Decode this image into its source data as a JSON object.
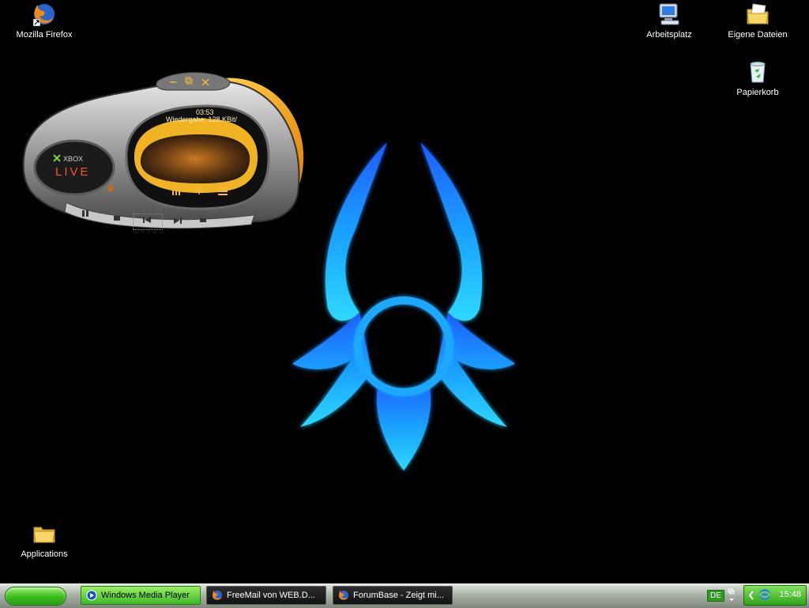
{
  "desktop": {
    "icons": [
      {
        "label": "Mozilla Firefox",
        "icon": "firefox-icon"
      },
      {
        "label": "Arbeitsplatz",
        "icon": "my-computer-icon"
      },
      {
        "label": "Eigene Dateien",
        "icon": "my-documents-icon"
      },
      {
        "label": "Papierkorb",
        "icon": "recycle-bin-icon"
      },
      {
        "label": "Applications",
        "icon": "folder-icon"
      }
    ]
  },
  "media_player": {
    "time": "03:53",
    "status": "Wiedergabe: 128 KBit/",
    "logo_top": "XBOX",
    "logo_bottom": "LIVE"
  },
  "taskbar": {
    "tasks": [
      {
        "label": "Windows Media Player",
        "icon": "media-player-icon",
        "active": true
      },
      {
        "label": "FreeMail von WEB.D...",
        "icon": "firefox-icon",
        "active": false
      },
      {
        "label": "ForumBase - Zeigt mi...",
        "icon": "firefox-icon",
        "active": false
      }
    ],
    "language": "DE",
    "clock": "15:48"
  },
  "colors": {
    "taskbar_active": "#3fb725",
    "start_button": "#3fbf20",
    "emblem_glow": "#1aa8ff",
    "player_accent": "#f3a20f"
  }
}
